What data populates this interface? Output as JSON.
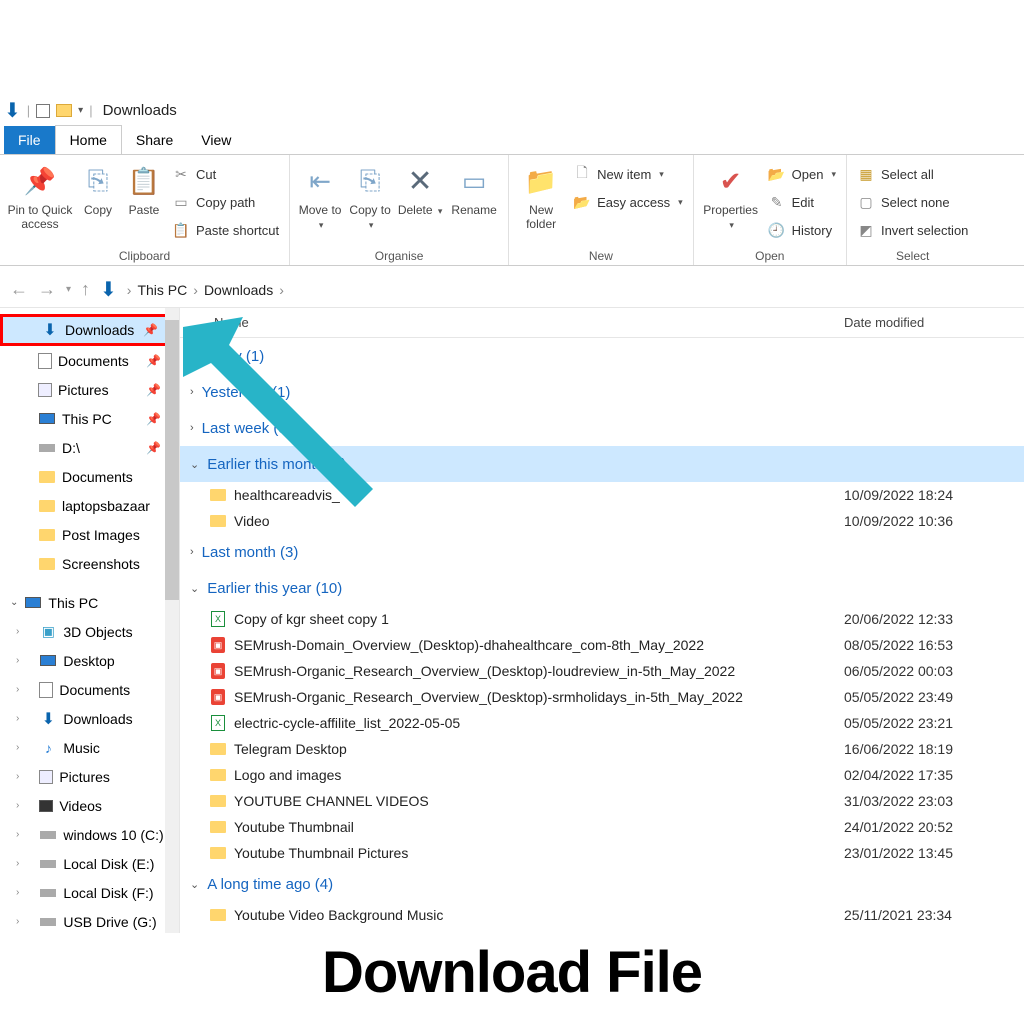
{
  "window": {
    "title": "Downloads"
  },
  "tabs": {
    "file": "File",
    "home": "Home",
    "share": "Share",
    "view": "View"
  },
  "ribbon": {
    "clipboard": {
      "label": "Clipboard",
      "pin": "Pin to Quick access",
      "copy": "Copy",
      "paste": "Paste",
      "cut": "Cut",
      "copypath": "Copy path",
      "pasteshortcut": "Paste shortcut"
    },
    "organise": {
      "label": "Organise",
      "moveto": "Move to",
      "copyto": "Copy to",
      "delete": "Delete",
      "rename": "Rename"
    },
    "new": {
      "label": "New",
      "newfolder": "New folder",
      "newitem": "New item",
      "easyaccess": "Easy access"
    },
    "open": {
      "label": "Open",
      "properties": "Properties",
      "open": "Open",
      "edit": "Edit",
      "history": "History"
    },
    "select": {
      "label": "Select",
      "selectall": "Select all",
      "selectnone": "Select none",
      "invert": "Invert selection"
    }
  },
  "breadcrumb": {
    "root": "This PC",
    "current": "Downloads"
  },
  "columns": {
    "name": "Name",
    "date": "Date modified"
  },
  "sidebar": {
    "quick": [
      {
        "label": "Downloads",
        "icon": "down",
        "pinned": true,
        "highlight": true
      },
      {
        "label": "Documents",
        "icon": "doc",
        "pinned": true
      },
      {
        "label": "Pictures",
        "icon": "pic",
        "pinned": true
      },
      {
        "label": "This PC",
        "icon": "pc",
        "pinned": true
      },
      {
        "label": "D:\\",
        "icon": "disk",
        "pinned": true
      },
      {
        "label": "Documents",
        "icon": "folder"
      },
      {
        "label": "laptopsbazaar",
        "icon": "folder"
      },
      {
        "label": "Post Images",
        "icon": "folder"
      },
      {
        "label": "Screenshots",
        "icon": "folder"
      }
    ],
    "thispc_label": "This PC",
    "thispc": [
      {
        "label": "3D Objects",
        "icon": "3d"
      },
      {
        "label": "Desktop",
        "icon": "monitor"
      },
      {
        "label": "Documents",
        "icon": "doc"
      },
      {
        "label": "Downloads",
        "icon": "down"
      },
      {
        "label": "Music",
        "icon": "music"
      },
      {
        "label": "Pictures",
        "icon": "pic"
      },
      {
        "label": "Videos",
        "icon": "video"
      },
      {
        "label": "windows 10 (C:)",
        "icon": "disk"
      },
      {
        "label": "Local Disk (E:)",
        "icon": "disk"
      },
      {
        "label": "Local Disk (F:)",
        "icon": "disk"
      },
      {
        "label": "USB Drive (G:)",
        "icon": "disk"
      }
    ]
  },
  "groups": [
    {
      "label": "Today (1)",
      "expanded": false
    },
    {
      "label": "Yesterday (1)",
      "expanded": false
    },
    {
      "label": "Last week (5)",
      "expanded": false
    },
    {
      "label": "Earlier this month (2)",
      "expanded": true,
      "selected": true,
      "files": [
        {
          "name": "healthcareadvis_",
          "date": "10/09/2022 18:24",
          "type": "folder"
        },
        {
          "name": "Video",
          "date": "10/09/2022 10:36",
          "type": "folder"
        }
      ]
    },
    {
      "label": "Last month (3)",
      "expanded": false
    },
    {
      "label": "Earlier this year (10)",
      "expanded": true,
      "files": [
        {
          "name": "Copy of kgr sheet copy 1",
          "date": "20/06/2022 12:33",
          "type": "xls"
        },
        {
          "name": "SEMrush-Domain_Overview_(Desktop)-dhahealthcare_com-8th_May_2022",
          "date": "08/05/2022 16:53",
          "type": "pdf"
        },
        {
          "name": "SEMrush-Organic_Research_Overview_(Desktop)-loudreview_in-5th_May_2022",
          "date": "06/05/2022 00:03",
          "type": "pdf"
        },
        {
          "name": "SEMrush-Organic_Research_Overview_(Desktop)-srmholidays_in-5th_May_2022",
          "date": "05/05/2022 23:49",
          "type": "pdf"
        },
        {
          "name": "electric-cycle-affilite_list_2022-05-05",
          "date": "05/05/2022 23:21",
          "type": "xls"
        },
        {
          "name": "Telegram Desktop",
          "date": "16/06/2022 18:19",
          "type": "folder"
        },
        {
          "name": "Logo and images",
          "date": "02/04/2022 17:35",
          "type": "folder"
        },
        {
          "name": "YOUTUBE CHANNEL VIDEOS",
          "date": "31/03/2022 23:03",
          "type": "folder"
        },
        {
          "name": "Youtube Thumbnail",
          "date": "24/01/2022 20:52",
          "type": "folder"
        },
        {
          "name": "Youtube Thumbnail Pictures",
          "date": "23/01/2022 13:45",
          "type": "folder"
        }
      ]
    },
    {
      "label": "A long time ago (4)",
      "expanded": true,
      "files": [
        {
          "name": "Youtube Video Background Music",
          "date": "25/11/2021 23:34",
          "type": "folder"
        }
      ]
    }
  ],
  "caption": "Download File"
}
